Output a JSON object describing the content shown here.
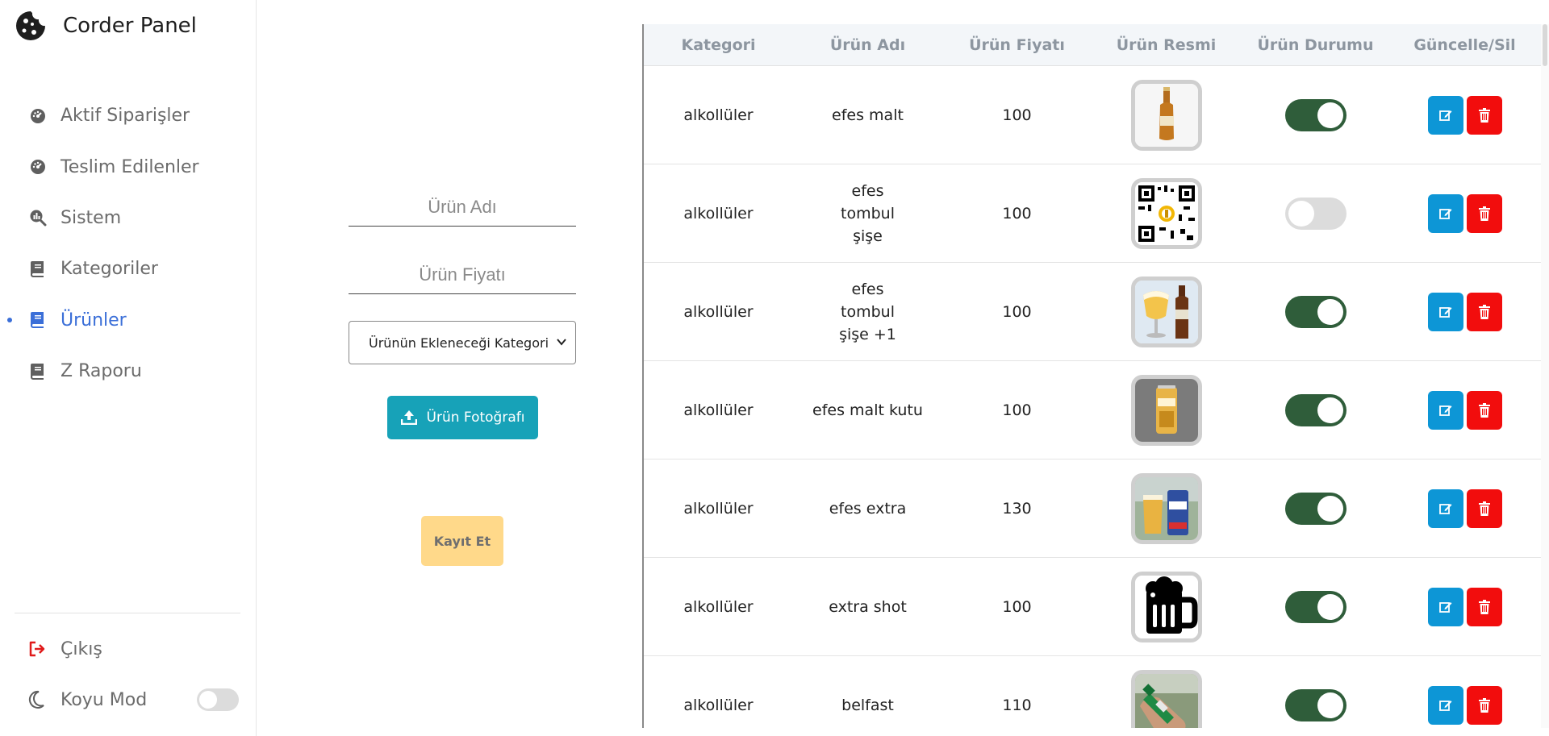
{
  "brand": {
    "title": "Corder Panel"
  },
  "sidebar": {
    "items": [
      {
        "label": "Aktif Siparişler",
        "icon": "dashboard-icon",
        "active": false
      },
      {
        "label": "Teslim Edilenler",
        "icon": "dashboard-icon",
        "active": false
      },
      {
        "label": "Sistem",
        "icon": "chart-search-icon",
        "active": false
      },
      {
        "label": "Kategoriler",
        "icon": "book-icon",
        "active": false
      },
      {
        "label": "Ürünler",
        "icon": "book-icon",
        "active": true
      },
      {
        "label": "Z Raporu",
        "icon": "book-icon",
        "active": false
      }
    ],
    "logout_label": "Çıkış",
    "darkmode_label": "Koyu Mod",
    "darkmode_on": false
  },
  "form": {
    "name_placeholder": "Ürün Adı",
    "price_placeholder": "Ürün Fiyatı",
    "category_select": "Ürünün Ekleneceği Kategori",
    "upload_label": "Ürün Fotoğrafı",
    "save_label": "Kayıt Et"
  },
  "table": {
    "headers": [
      "Kategori",
      "Ürün Adı",
      "Ürün Fiyatı",
      "Ürün Resmi",
      "Ürün Durumu",
      "Güncelle/Sil"
    ],
    "rows": [
      {
        "category": "alkollüler",
        "name": "efes malt",
        "price": "100",
        "image": "beer-bottle-icon",
        "enabled": true
      },
      {
        "category": "alkollüler",
        "name": "efes tombul şişe",
        "price": "100",
        "image": "qr-code-icon",
        "enabled": false
      },
      {
        "category": "alkollüler",
        "name": "efes tombul şişe +1",
        "price": "100",
        "image": "beer-glass-bottle-icon",
        "enabled": true
      },
      {
        "category": "alkollüler",
        "name": "efes malt kutu",
        "price": "100",
        "image": "beer-can-icon",
        "enabled": true
      },
      {
        "category": "alkollüler",
        "name": "efes extra",
        "price": "130",
        "image": "beer-glass-can-icon",
        "enabled": true
      },
      {
        "category": "alkollüler",
        "name": "extra shot",
        "price": "100",
        "image": "beer-mug-icon",
        "enabled": true
      },
      {
        "category": "alkollüler",
        "name": "belfast",
        "price": "110",
        "image": "green-bottle-icon",
        "enabled": true
      }
    ]
  },
  "colors": {
    "accent": "#3b6fd8",
    "upload": "#17a2b8",
    "save": "#ffd98a",
    "edit": "#0d96d6",
    "delete": "#f20d0d",
    "toggle_on": "#2f5d3a"
  }
}
